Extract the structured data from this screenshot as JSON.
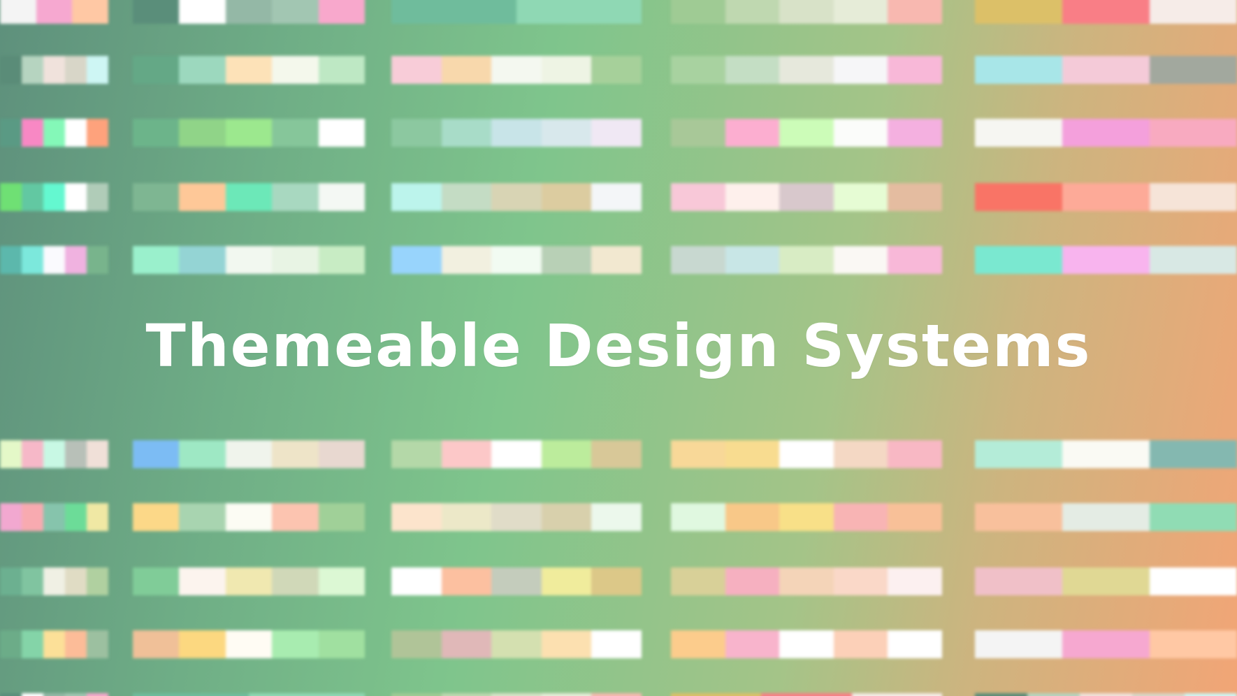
{
  "title": "Themeable Design Systems",
  "palettes": [
    [
      "#f4f4f4",
      "#f6a8d0",
      "#ffc8a4"
    ],
    [
      "#5a8e7a",
      "#ffffff",
      "#94b8a6",
      "#a2c6b2",
      "#f8a8cc"
    ],
    [
      "#6fbc9c",
      "#8fd8b4"
    ],
    [
      "#9fcb94",
      "#bfd8b0",
      "#d8e2c8",
      "#e6ecd8",
      "#f8b8b0"
    ],
    [
      "#dcc068",
      "#f97e86",
      "#f6ece8"
    ],
    [
      "#5a8c78",
      "#b6d4c0",
      "#f0e2dc",
      "#d8d6c8",
      "#cef6f4"
    ],
    [
      "#64a886",
      "#9cd8be",
      "#fde2b8",
      "#f4f8ec",
      "#bee8c4"
    ],
    [
      "#f8ccd8",
      "#f8d8ac",
      "#f4f8f0",
      "#eef4e4",
      "#a6d09a"
    ],
    [
      "#a8d2a0",
      "#c4dec4",
      "#e6e8dc",
      "#f6f6f8",
      "#f8b8d8"
    ],
    [
      "#a8e6e8",
      "#f4cad8",
      "#a2a89e"
    ],
    [
      "#5a9a84",
      "#f888c4",
      "#84f8b8",
      "#ffffff",
      "#fea27c"
    ],
    [
      "#6cb48a",
      "#90d488",
      "#9ce88e",
      "#86c69a",
      "#ffffff"
    ],
    [
      "#8cc8a0",
      "#a8dcc8",
      "#c8e4e8",
      "#d8e8ec",
      "#f0e8f4"
    ],
    [
      "#a8c898",
      "#fcaed0",
      "#ccfcb8",
      "#fbfcfa",
      "#f4b0e0"
    ],
    [
      "#f6f6f2",
      "#f4a0dc",
      "#f8aac0"
    ],
    [
      "#6fe074",
      "#62c8a2",
      "#64f8d0",
      "#ffffff",
      "#b0ccb8"
    ],
    [
      "#7eb692",
      "#fec898",
      "#6ce8b8",
      "#a8d8c0",
      "#f4f8f4"
    ],
    [
      "#bcf4ec",
      "#c4dcc4",
      "#d8d4b4",
      "#dccca0",
      "#f4f6f8"
    ],
    [
      "#f8c8d8",
      "#fef0ec",
      "#d8c8cc",
      "#e6fcd4",
      "#e4bca0"
    ],
    [
      "#f97466",
      "#fdaa98",
      "#f6e4d8"
    ],
    [
      "#5cb8ac",
      "#7ce8dc",
      "#fafafe",
      "#f0b2e0",
      "#78b48c"
    ],
    [
      "#9af0cc",
      "#94d4d4",
      "#f2f8f0",
      "#e8f4e4",
      "#c8ecc4"
    ],
    [
      "#98d4fc",
      "#f2f0e0",
      "#f2fbf2",
      "#b8d0b6",
      "#f2e8d0"
    ],
    [
      "#c8d8d0",
      "#c8e6e6",
      "#d8ecc4",
      "#faf8f4",
      "#f8b8d8"
    ],
    [
      "#7ae8d0",
      "#f8b4ee",
      "#d8e8e4"
    ],
    [
      "#e4f8c8",
      "#f6b8c8",
      "#c8f8e4",
      "#b8c0b8",
      "#f0e0d8"
    ],
    [
      "#7cbcf4",
      "#9ee8c4",
      "#f0f4ec",
      "#eee4c8",
      "#e8d8d0"
    ],
    [
      "#b4d8a8",
      "#fcc8c8",
      "#ffffff",
      "#bcec9c",
      "#d8c898"
    ],
    [
      "#f8d898",
      "#f8dc90",
      "#ffffff",
      "#f4d8c4",
      "#f8b8c4"
    ],
    [
      "#b4ecd8",
      "#fafaf4",
      "#84b8b0"
    ],
    [
      "#f2a8d0",
      "#f8aab0",
      "#86c4ac",
      "#6cdc98",
      "#f0e8a4"
    ],
    [
      "#fcd888",
      "#a8d4b0",
      "#fcfcf4",
      "#fcc4b0",
      "#a0d098"
    ],
    [
      "#fce4cc",
      "#ece8c8",
      "#e0dcc8",
      "#d8d0ac",
      "#ecf8ec"
    ],
    [
      "#e0f8e0",
      "#f8c888",
      "#f8e088",
      "#f8b4b4",
      "#f8c098"
    ],
    [
      "#f8c09c",
      "#e4ece4",
      "#90dcb4"
    ],
    [
      "#6cb090",
      "#80c4a0",
      "#f0f0e4",
      "#e0dcc4",
      "#b0d0a0"
    ],
    [
      "#80cc98",
      "#fcf4ee",
      "#f0e8b0",
      "#d0d8b8",
      "#dcf8d4"
    ],
    [
      "#ffffff",
      "#fcc0a0",
      "#c4ccbc",
      "#f0ec9c",
      "#dcc888"
    ],
    [
      "#d8d098",
      "#f6b0c0",
      "#f4d4b8",
      "#fad8c8",
      "#fcf0f0"
    ],
    [
      "#f0c0c8",
      "#e0d894",
      "#ffffff"
    ],
    [
      "#6cac88",
      "#84d4a8",
      "#fce098",
      "#fcbc98",
      "#9cc0a0"
    ],
    [
      "#f0c098",
      "#fcd880",
      "#fffcf4",
      "#a8ecb0",
      "#a0e0a0"
    ],
    [
      "#b0c498",
      "#e0b8b8",
      "#d4e0b0",
      "#fce0b0",
      "#ffffff"
    ],
    [
      "#fccc8c",
      "#f8b4cc",
      "#ffffff",
      "#fcd0b8",
      "#ffffff"
    ]
  ]
}
